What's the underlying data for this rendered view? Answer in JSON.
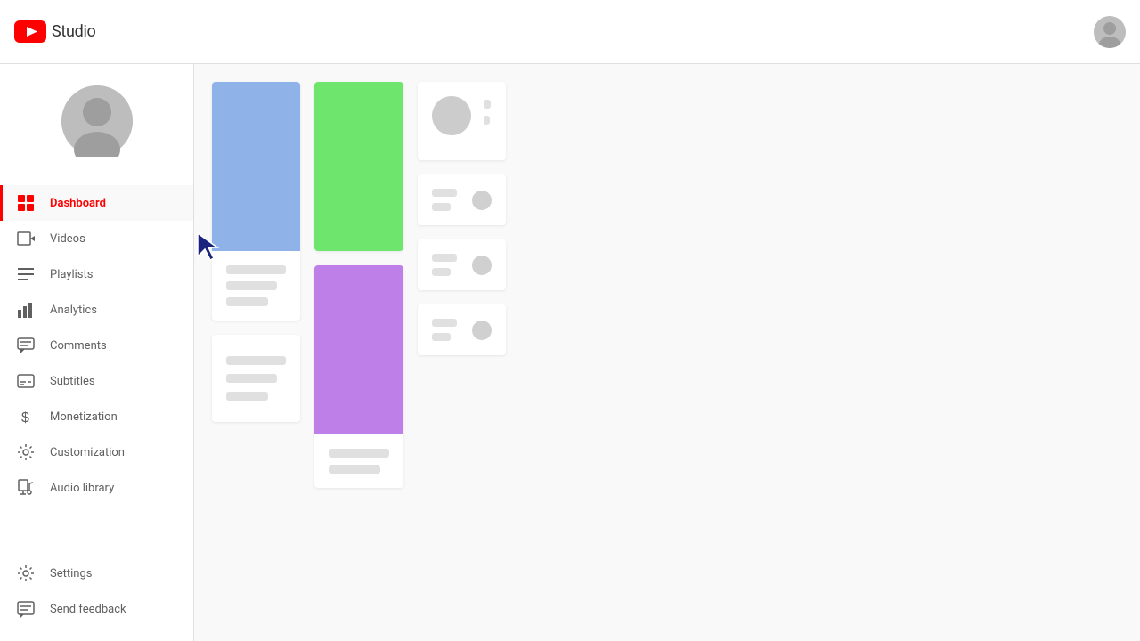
{
  "header": {
    "logo_text": "Studio",
    "title": "YouTube Studio"
  },
  "sidebar": {
    "nav_items": [
      {
        "id": "dashboard",
        "label": "Dashboard",
        "active": true
      },
      {
        "id": "videos",
        "label": "Videos",
        "active": false
      },
      {
        "id": "playlists",
        "label": "Playlists",
        "active": false
      },
      {
        "id": "analytics",
        "label": "Analytics",
        "active": false
      },
      {
        "id": "comments",
        "label": "Comments",
        "active": false
      },
      {
        "id": "subtitles",
        "label": "Subtitles",
        "active": false
      },
      {
        "id": "monetization",
        "label": "Monetization",
        "active": false
      },
      {
        "id": "customization",
        "label": "Customization",
        "active": false
      },
      {
        "id": "audio_library",
        "label": "Audio library",
        "active": false
      }
    ],
    "bottom_items": [
      {
        "id": "settings",
        "label": "Settings"
      },
      {
        "id": "send_feedback",
        "label": "Send feedback"
      }
    ]
  }
}
